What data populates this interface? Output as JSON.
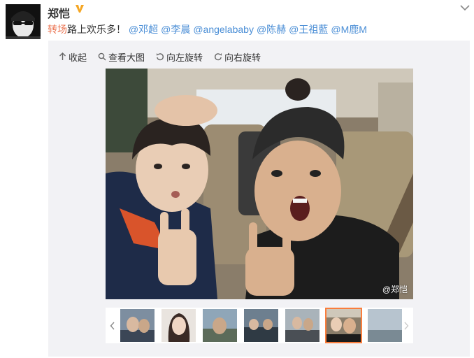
{
  "post": {
    "username": "郑恺",
    "verified_badge": "V",
    "topic": "转场",
    "body": "路上欢乐多！",
    "mentions": [
      "@邓超",
      "@李晨",
      "@angelababy",
      "@陈赫",
      "@王祖藍",
      "@M鹿M"
    ]
  },
  "toolbar": {
    "collapse_label": "收起",
    "view_large_label": "查看大图",
    "rotate_left_label": "向左旋转",
    "rotate_right_label": "向右旋转"
  },
  "photo": {
    "watermark": "@郑恺"
  },
  "thumbnails": {
    "count": 7,
    "selected_index": 5
  },
  "colors": {
    "topic": "#eb7350",
    "mention": "#4a8ed6",
    "badge": "#f5a623",
    "selected_thumb": "#fa7d3c"
  },
  "icons": [
    "collapse-arrow-icon",
    "search-icon",
    "rotate-left-icon",
    "rotate-right-icon",
    "chevron-down-icon",
    "chevron-left-icon",
    "chevron-right-icon"
  ]
}
